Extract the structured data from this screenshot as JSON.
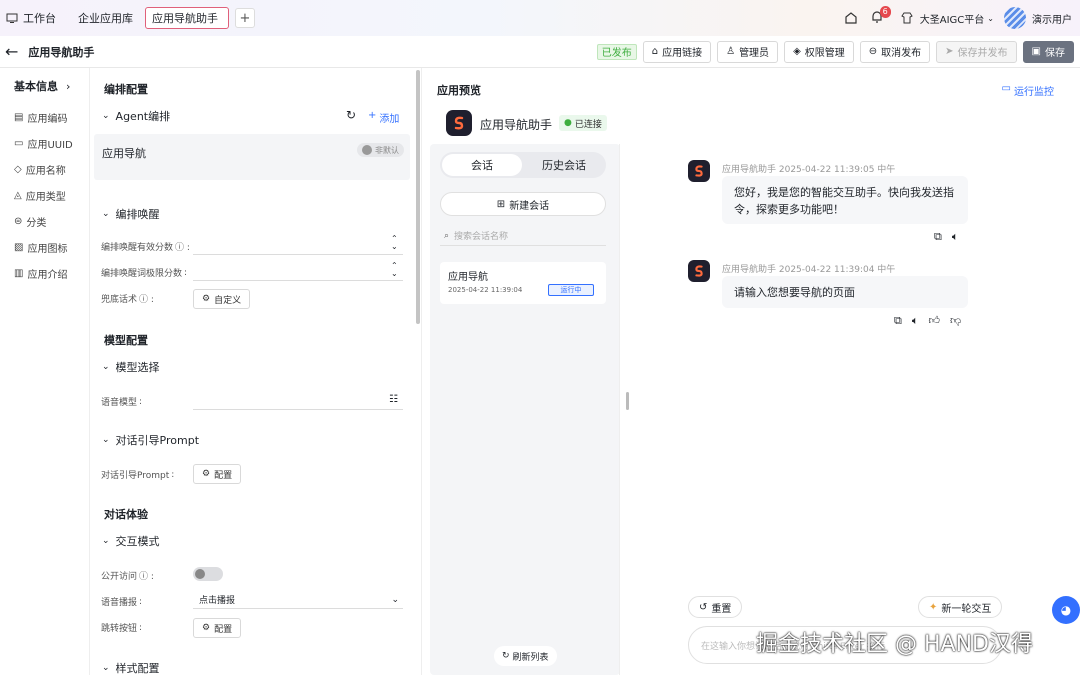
{
  "topbar": {
    "workbench": "工作台",
    "tabs": [
      "企业应用库",
      "应用导航助手"
    ],
    "add_tab": "+",
    "notifications": "6",
    "platform": "大圣AIGC平台",
    "user": "演示用户"
  },
  "header": {
    "back": "←",
    "title": "应用导航助手",
    "status": "已发布",
    "buttons": [
      "应用链接",
      "管理员",
      "权限管理",
      "取消发布",
      "保存并发布",
      "保存"
    ]
  },
  "leftnav": {
    "title": "基本信息",
    "items": [
      "应用编码",
      "应用UUID",
      "应用名称",
      "应用类型",
      "分类",
      "应用图标",
      "应用介绍"
    ]
  },
  "config": {
    "title": "编排配置",
    "agent": {
      "label": "Agent编排",
      "add": "添加",
      "item": "应用导航",
      "toggle": "非默认"
    },
    "wake": {
      "label": "编排唤醒",
      "threshold": "编排唤醒有效分数",
      "limit": "编排唤醒词极限分数",
      "fallback": "兜底话术",
      "custom": "自定义"
    },
    "model_title": "模型配置",
    "model": {
      "label": "模型选择",
      "field": "语音模型"
    },
    "prompt": {
      "label": "对话引导Prompt",
      "field": "对话引导Prompt",
      "btn": "配置"
    },
    "experience_title": "对话体验",
    "interact": {
      "label": "交互模式",
      "public": "公开访问",
      "voice": "语音播报",
      "voice_value": "点击播报",
      "jump": "跳转按钮",
      "btn": "配置"
    },
    "style": "样式配置"
  },
  "preview": {
    "title": "应用预览",
    "monitor": "运行监控",
    "app_name": "应用导航助手",
    "connected": "已连接",
    "tab_chat": "会话",
    "tab_history": "历史会话",
    "new_chat": "新建会话",
    "search_placeholder": "搜索会话名称",
    "session": {
      "name": "应用导航",
      "time": "2025-04-22 11:39:04",
      "status": "运行中"
    },
    "refresh": "刷新列表",
    "messages": [
      {
        "meta": "应用导航助手 2025-04-22 11:39:05 中午",
        "text1": "您好，我是您的智能交互助手。快向我发送指",
        "text2": "令，探索更多功能吧！"
      },
      {
        "meta": "应用导航助手 2025-04-22 11:39:04 中午",
        "text1": "请输入您想要导航的页面"
      }
    ],
    "reset": "重置",
    "new_round": "新一轮交互",
    "input_placeholder": "在这输入你想说的话，或用 Shift+Enter 换行"
  },
  "watermark": "掘金技术社区 @ HAND汉得"
}
